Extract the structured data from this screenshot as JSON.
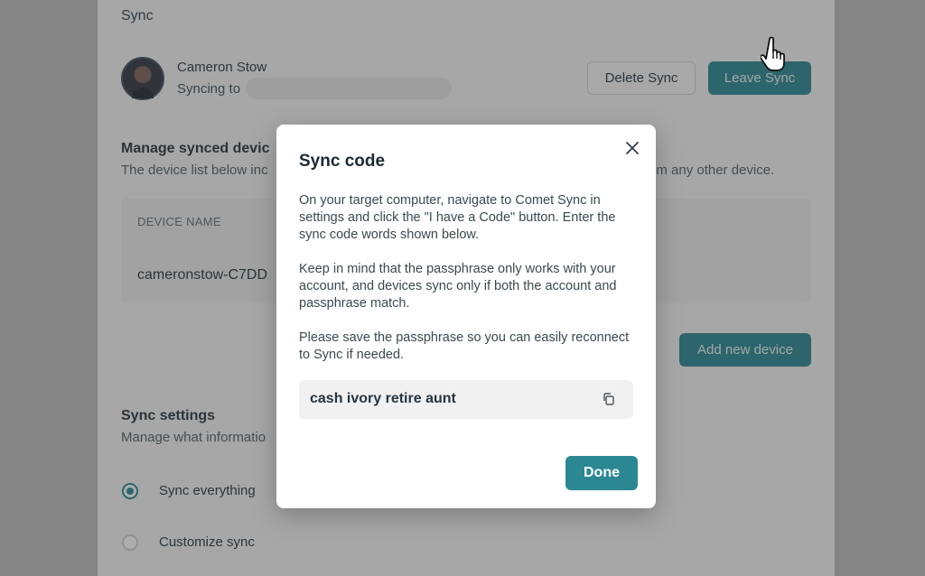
{
  "page": {
    "section_title": "Sync",
    "account": {
      "name": "Cameron Stow",
      "syncing_to_label": "Syncing to"
    },
    "buttons": {
      "delete_sync": "Delete Sync",
      "leave_sync": "Leave Sync",
      "add_new_device": "Add new device"
    },
    "manage": {
      "heading": "Manage synced devic",
      "description_left": "The device list below inc",
      "description_right": "om any other device."
    },
    "device_table": {
      "column_header": "DEVICE NAME",
      "rows": [
        "cameronstow-C7DD"
      ]
    },
    "sync_settings": {
      "heading": "Sync settings",
      "description": "Manage what informatio",
      "options": [
        {
          "label": "Sync everything",
          "selected": true
        },
        {
          "label": "Customize sync",
          "selected": false
        }
      ]
    },
    "accent_color": "#24838f"
  },
  "modal": {
    "title": "Sync code",
    "paragraph_1": "On your target computer, navigate to Comet Sync in settings and click the \"I have a Code\" button. Enter the sync code words shown below.",
    "paragraph_2": "Keep in mind that the passphrase only works with your account, and devices sync only if both the account and passphrase match.",
    "paragraph_3": "Please save the passphrase so you can easily reconnect to Sync if needed.",
    "sync_code": "cash ivory retire aunt",
    "done_label": "Done",
    "close_icon": "close-icon",
    "copy_icon": "copy-icon"
  }
}
